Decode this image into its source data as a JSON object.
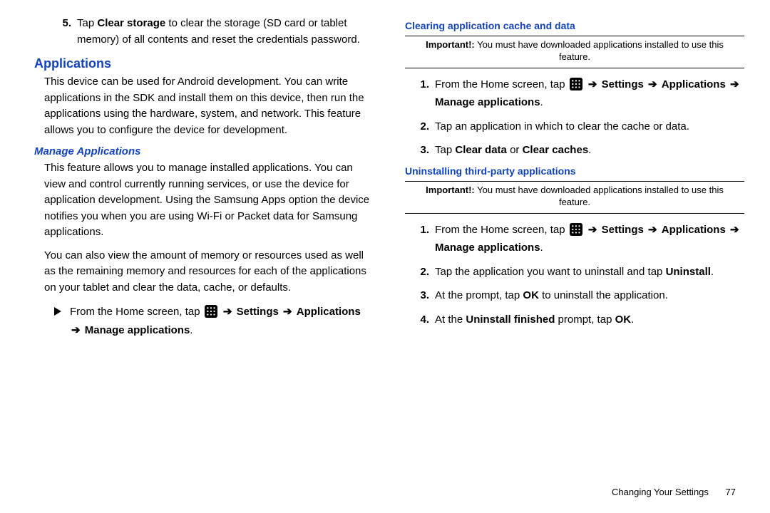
{
  "left": {
    "step5_num": "5.",
    "step5_prefix": "Tap ",
    "step5_bold": "Clear storage",
    "step5_rest": " to clear the storage (SD card or tablet memory) of all contents and reset the credentials password.",
    "h1": "Applications",
    "p1": "This device can be used for Android development. You can write applications in the SDK and install them on this device, then run the applications using the hardware, system, and network. This feature allows you to configure the device for development.",
    "h2": "Manage Applications",
    "p2": "This feature allows you to manage installed applications. You can view and control currently running services, or use the device for application development. Using the Samsung Apps option the device notifies you when you are using Wi-Fi or Packet data for Samsung applications.",
    "p3": "You can also view the amount of memory or resources used as well as the remaining memory and resources for each of the applications on your tablet and clear the data, cache, or defaults.",
    "nav_prefix": "From the Home screen, tap ",
    "nav_settings": "Settings",
    "nav_apps": "Applications",
    "nav_manage": "Manage applications"
  },
  "right": {
    "h3a": "Clearing application cache and data",
    "note_label": "Important!:",
    "note_text": " You must have downloaded applications installed to use this feature.",
    "a1_num": "1.",
    "a1_prefix": "From the Home screen, tap ",
    "a_settings": "Settings",
    "a_apps": "Applications",
    "a_manage": "Manage applications",
    "a2_num": "2.",
    "a2_text": "Tap an application in which to clear the cache or data.",
    "a3_num": "3.",
    "a3_prefix": "Tap ",
    "a3_b1": "Clear data",
    "a3_mid": " or ",
    "a3_b2": "Clear caches",
    "h3b": "Uninstalling third-party applications",
    "b1_num": "1.",
    "b1_prefix": "From the Home screen, tap ",
    "b2_num": "2.",
    "b2_prefix": "Tap the application you want to uninstall and tap ",
    "b2_bold": "Uninstall",
    "b3_num": "3.",
    "b3_prefix": "At the prompt, tap ",
    "b3_bold": "OK",
    "b3_rest": " to uninstall the application.",
    "b4_num": "4.",
    "b4_prefix": "At the ",
    "b4_bold": "Uninstall finished",
    "b4_mid": " prompt, tap ",
    "b4_bold2": "OK"
  },
  "arrow": "➔",
  "dot": ".",
  "footer": {
    "section": "Changing Your Settings",
    "page": "77"
  }
}
